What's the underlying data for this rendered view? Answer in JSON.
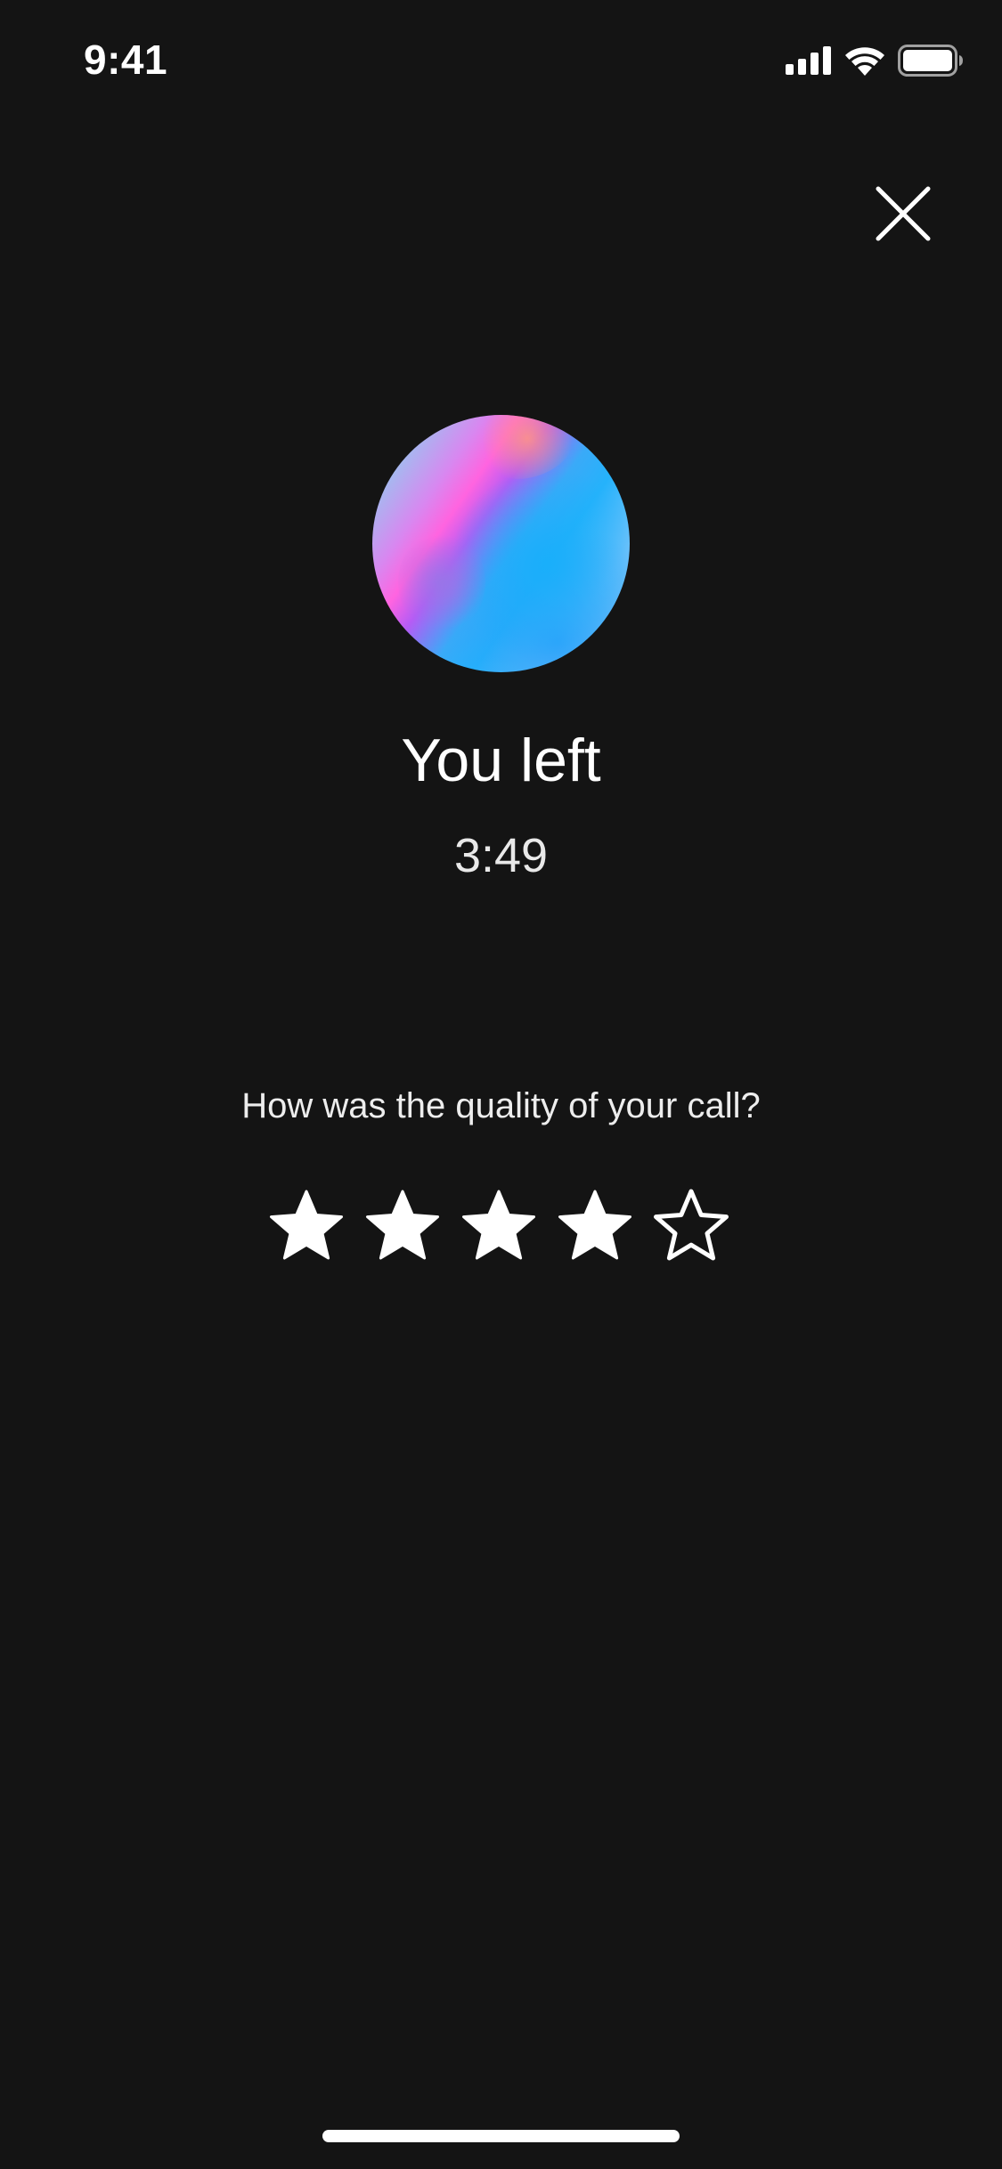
{
  "status_bar": {
    "time": "9:41",
    "icons": [
      "cellular-signal-icon",
      "wifi-icon",
      "battery-icon"
    ]
  },
  "close_icon": "close-icon",
  "call": {
    "title": "You left",
    "duration": "3:49"
  },
  "rating": {
    "question": "How was the quality of your call?",
    "value": 4,
    "max": 5
  },
  "colors": {
    "background": "#141414",
    "text": "#ffffff"
  }
}
